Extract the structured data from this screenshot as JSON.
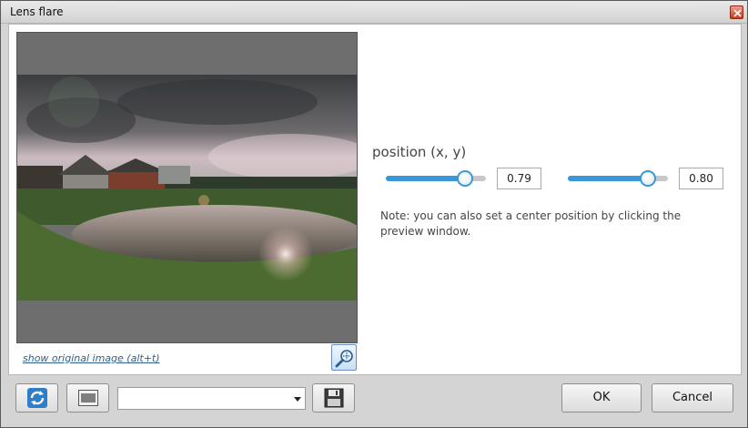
{
  "window": {
    "title": "Lens flare"
  },
  "preview": {
    "show_original_label": "show original image (alt+t)"
  },
  "params": {
    "position_label": "position (x, y)",
    "x_value": "0.79",
    "y_value": "0.80",
    "x_level": 0.79,
    "y_level": 0.8,
    "note": "Note: you can also set a center position by clicking the preview window."
  },
  "footer": {
    "preset_value": "",
    "ok_label": "OK",
    "cancel_label": "Cancel"
  },
  "colors": {
    "accent": "#3a98d8",
    "link": "#2f5f8f"
  }
}
